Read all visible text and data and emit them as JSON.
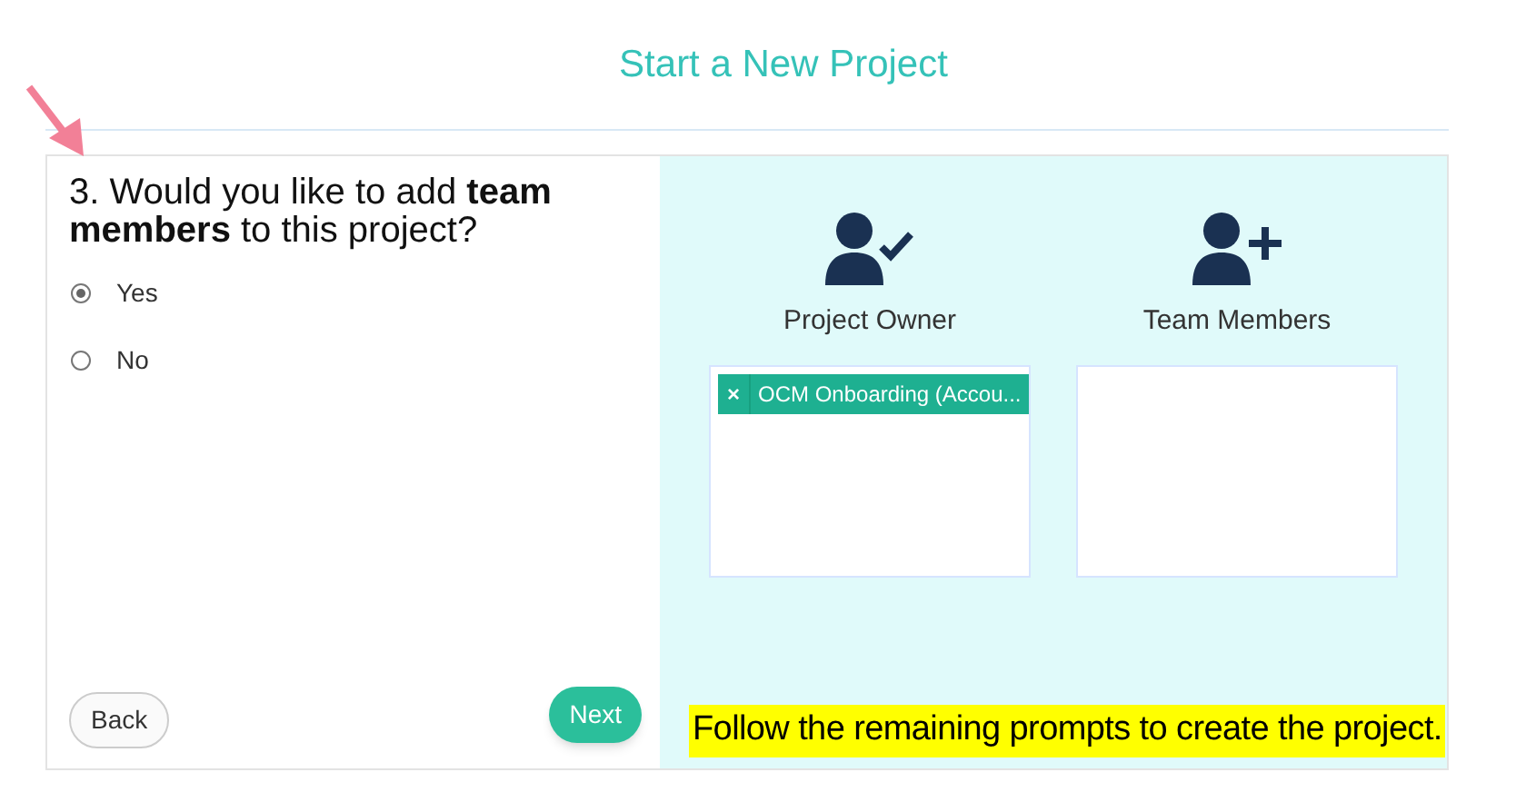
{
  "title": "Start a New Project",
  "question": {
    "text": "3. Would you like to add **team members** to this project?",
    "options": [
      {
        "label": "Yes",
        "selected": true
      },
      {
        "label": "No",
        "selected": false
      }
    ]
  },
  "owner": {
    "label": "Project Owner",
    "tags": [
      {
        "remove": "×",
        "label": "OCM Onboarding (Accou..."
      }
    ]
  },
  "members": {
    "label": "Team Members"
  },
  "buttons": {
    "back": "Back",
    "next": "Next"
  },
  "callout": "Follow the remaining prompts to create the project."
}
